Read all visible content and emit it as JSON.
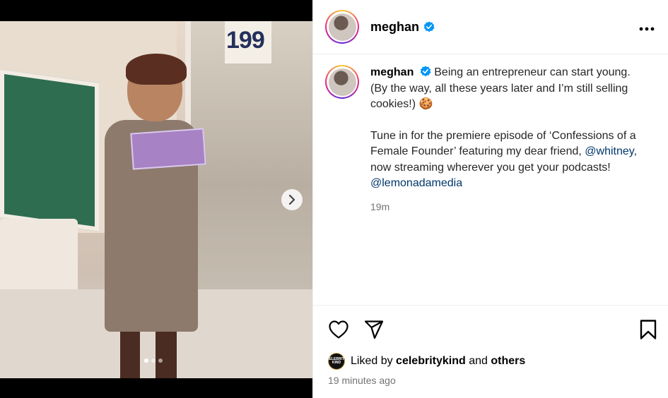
{
  "media": {
    "price_sign": "199",
    "next_icon": "chevron-right-icon",
    "carousel_total": 3,
    "carousel_active": 1
  },
  "header": {
    "username": "meghan",
    "verified_icon": "verified-badge-icon",
    "more_icon": "more-horizontal-icon"
  },
  "caption": {
    "username": "meghan",
    "para1": " Being an entrepreneur can start young. (By the way, all these years later and I’m still selling cookies!) 🍪",
    "para2_pre": "Tune in for the premiere episode of ‘Confessions of a Female Founder’ featuring my dear friend, ",
    "mention1": "@whitney",
    "para2_mid": ", now streaming wherever you get your podcasts! ",
    "mention2": "@lemonadamedia",
    "time_short": "19m"
  },
  "actions": {
    "like_icon": "heart-icon",
    "share_icon": "send-icon",
    "save_icon": "bookmark-icon"
  },
  "likes": {
    "avatar_text": "CELEBRITY KIND",
    "prefix": "Liked by ",
    "user": "celebritykind",
    "middle": " and ",
    "others": "others",
    "time_long": "19 minutes ago"
  },
  "colors": {
    "link": "#00376b",
    "verified": "#0095f6",
    "muted": "#737373"
  }
}
